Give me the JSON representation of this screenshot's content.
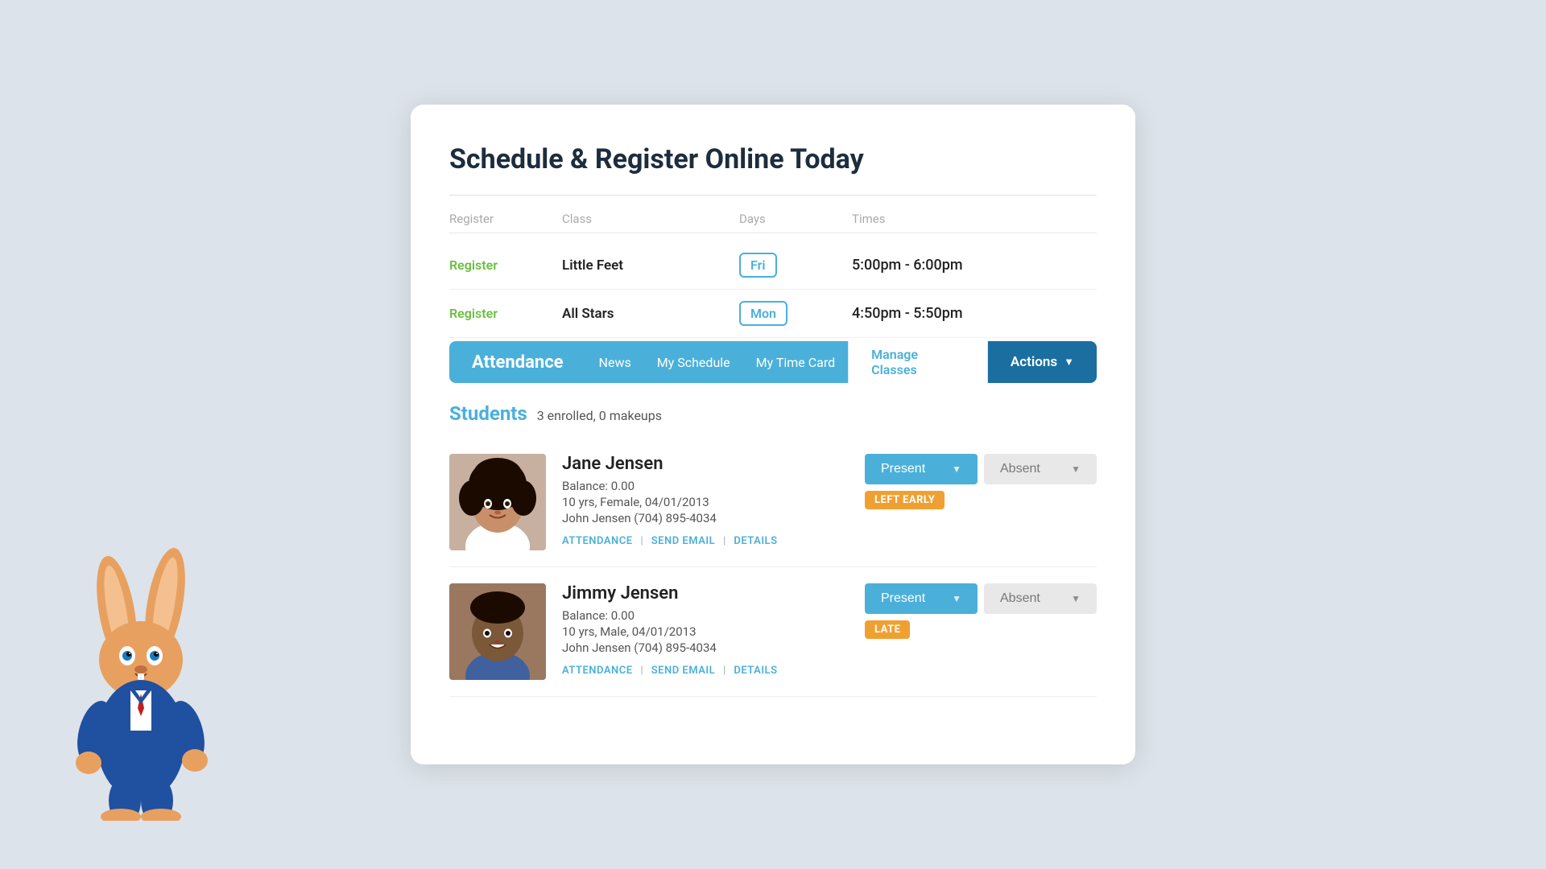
{
  "page": {
    "title": "Schedule & Register Online Today"
  },
  "schedule": {
    "headers": {
      "register": "Register",
      "class": "Class",
      "days": "Days",
      "times": "Times"
    },
    "rows": [
      {
        "register_label": "Register",
        "class_name": "Little Feet",
        "day": "Fri",
        "times": "5:00pm - 6:00pm"
      },
      {
        "register_label": "Register",
        "class_name": "All Stars",
        "day": "Mon",
        "times": "4:50pm - 5:50pm"
      }
    ]
  },
  "nav": {
    "attendance": "Attendance",
    "news": "News",
    "my_schedule": "My Schedule",
    "my_time_card": "My Time Card",
    "manage_classes": "Manage Classes",
    "actions": "Actions"
  },
  "students": {
    "title": "Students",
    "count": "3 enrolled, 0 makeups",
    "list": [
      {
        "name": "Jane Jensen",
        "balance": "Balance: 0.00",
        "details": "10 yrs, Female, 04/01/2013",
        "contact": "John Jensen (704) 895-4034",
        "present_label": "Present",
        "absent_label": "Absent",
        "status": "LEFT EARLY",
        "attendance_link": "ATTENDANCE",
        "email_link": "SEND EMAIL",
        "details_link": "DETAILS"
      },
      {
        "name": "Jimmy Jensen",
        "balance": "Balance: 0.00",
        "details": "10 yrs, Male, 04/01/2013",
        "contact": "John Jensen (704) 895-4034",
        "present_label": "Present",
        "absent_label": "Absent",
        "status": "LATE",
        "attendance_link": "ATTENDANCE",
        "email_link": "SEND EMAIL",
        "details_link": "DETAILS"
      }
    ]
  },
  "colors": {
    "primary": "#4ab0d9",
    "accent_green": "#6abf40",
    "accent_dark_blue": "#1a6fa0",
    "orange": "#f0a030"
  }
}
